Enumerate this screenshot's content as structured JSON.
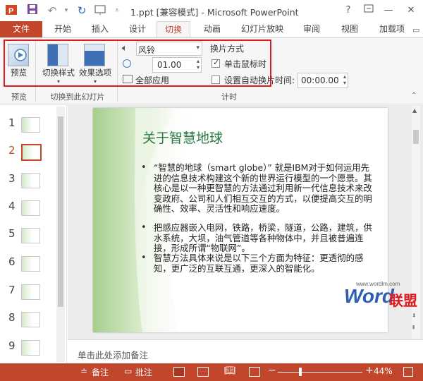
{
  "titlebar": {
    "title": "1.ppt [兼容模式] - Microsoft PowerPoint",
    "help": "?",
    "minimize": "—",
    "close": "✕"
  },
  "tabs": {
    "file": "文件",
    "items": [
      "开始",
      "插入",
      "设计",
      "切换",
      "动画",
      "幻灯片放映",
      "审阅",
      "视图",
      "加载项"
    ],
    "active": "切换"
  },
  "ribbon": {
    "preview": "预览",
    "transition_style": "切换样式",
    "effect_options": "效果选项",
    "sound_value": "风铃",
    "duration_value": "01.00",
    "apply_all": "全部应用",
    "advance_heading": "换片方式",
    "on_click": "单击鼠标时",
    "on_click_checked": true,
    "auto_advance": "设置自动换片时间:",
    "auto_advance_checked": false,
    "auto_time": "00:00.00",
    "group_preview": "预览",
    "group_transition": "切换到此幻灯片",
    "group_timing": "计时"
  },
  "slides": {
    "numbers": [
      "1",
      "2",
      "3",
      "4",
      "5",
      "6",
      "7",
      "8",
      "9"
    ],
    "selected": "2"
  },
  "slide": {
    "title": "关于智慧地球",
    "bullets": [
      "“智慧的地球（smart globe）” 就是IBM对于如何运用先进的信息技术构建这个新的世界运行模型的一个愿景。其核心是以一种更智慧的方法通过利用新一代信息技术来改变政府、公司和人们相互交互的方式，以便提高交互的明确性、效率、灵活性和响应速度。",
      "把感应器嵌入电网，铁路，桥梁，隧道，公路，建筑，供水系统，大坝，油气管道等各种物体中，并且被普遍连接，形成所谓“物联网”。",
      "智慧方法具体来说是以下三个方面为特征：更透彻的感知，更广泛的互联互通，更深入的智能化。"
    ],
    "watermark_url": "www.wordlm.com",
    "watermark_word": "Word",
    "watermark_cn": "联盟"
  },
  "notes": {
    "placeholder": "单击此处添加备注"
  },
  "status": {
    "notes": "备注",
    "comments": "批注",
    "zoom": "44%",
    "minus": "−",
    "plus": "+"
  },
  "colors": {
    "accent": "#c1462b",
    "highlight": "#e0191e",
    "slide_title": "#2b7a44"
  }
}
